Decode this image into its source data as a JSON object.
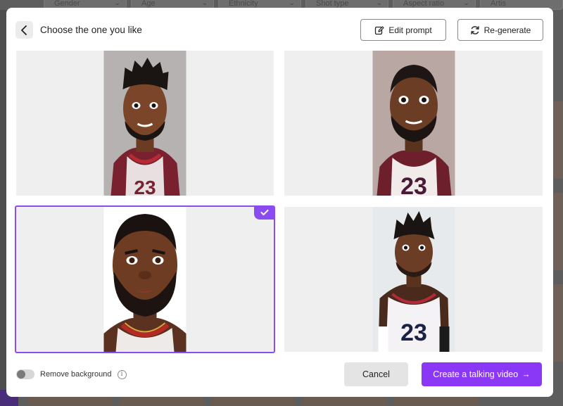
{
  "background": {
    "filters": [
      "Gender",
      "Age",
      "Ethnicity",
      "Shot type",
      "Aspect ratio",
      "Artis"
    ]
  },
  "dialog": {
    "title": "Choose the one you like",
    "edit_prompt_label": "Edit prompt",
    "regenerate_label": "Re-generate",
    "selected_index": 2,
    "options": [
      {
        "jersey_number": "23",
        "bg": "#b5b2b1"
      },
      {
        "jersey_number": "23",
        "bg": "#b9a7a4"
      },
      {
        "jersey_number": "",
        "bg": "#ffffff"
      },
      {
        "jersey_number": "23",
        "bg": "#e6eaec"
      }
    ],
    "remove_background_label": "Remove background",
    "remove_background_on": false,
    "info_glyph": "i",
    "cancel_label": "Cancel",
    "create_label": "Create a talking video",
    "create_arrow": "→"
  },
  "colors": {
    "accent": "#8a38f5",
    "selection": "#8a4cf0"
  }
}
